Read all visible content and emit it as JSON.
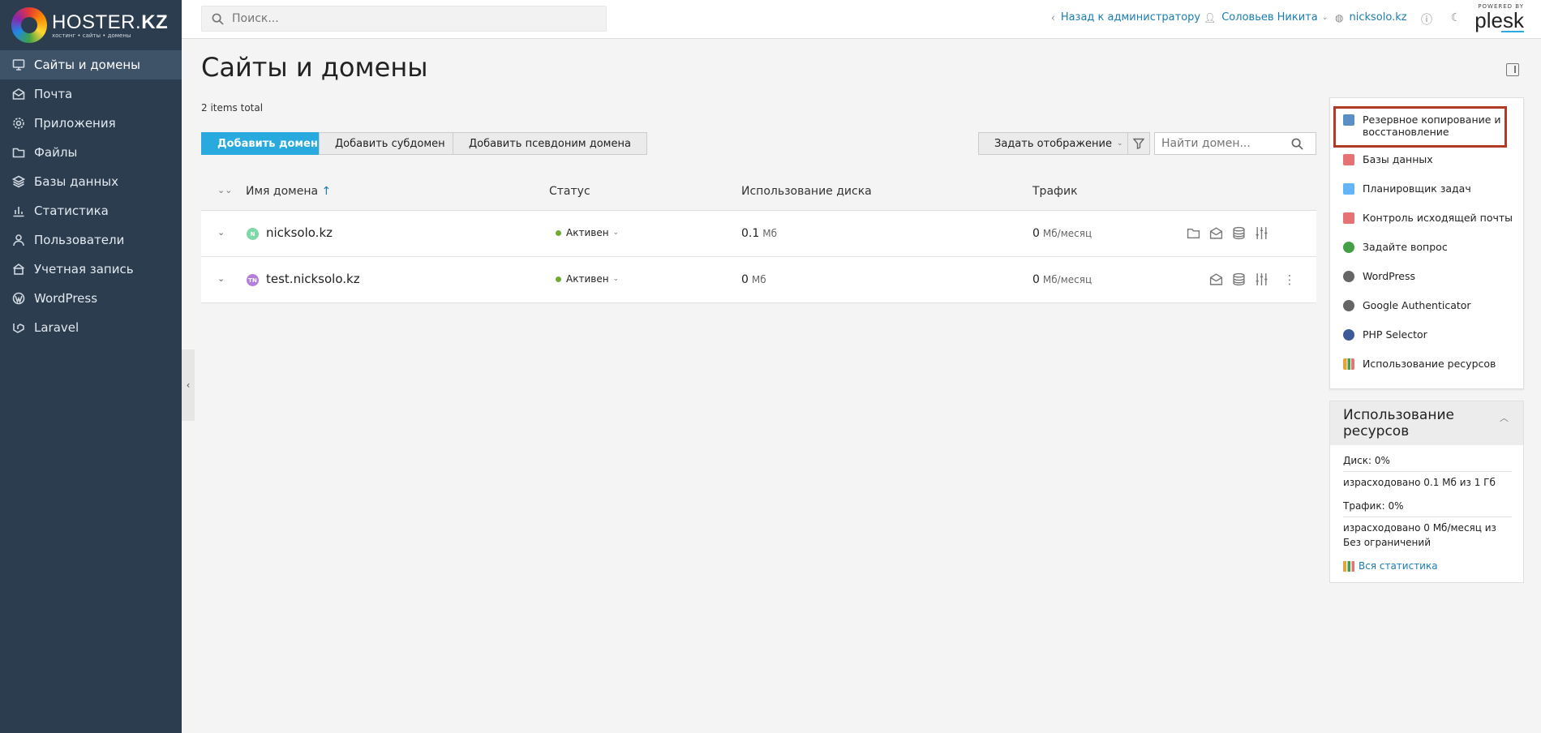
{
  "brand": {
    "logo_main": "HOSTER.",
    "logo_bold": "KZ",
    "logo_sub": "хостинг • сайты • домены"
  },
  "sidebar": {
    "items": [
      {
        "label": "Сайты и домены",
        "icon": "monitor-icon",
        "active": true
      },
      {
        "label": "Почта",
        "icon": "mail-icon"
      },
      {
        "label": "Приложения",
        "icon": "gear-icon"
      },
      {
        "label": "Файлы",
        "icon": "folder-icon"
      },
      {
        "label": "Базы данных",
        "icon": "layers-icon"
      },
      {
        "label": "Статистика",
        "icon": "chart-icon"
      },
      {
        "label": "Пользователи",
        "icon": "user-icon"
      },
      {
        "label": "Учетная запись",
        "icon": "account-icon"
      },
      {
        "label": "WordPress",
        "icon": "wordpress-icon"
      },
      {
        "label": "Laravel",
        "icon": "laravel-icon"
      }
    ]
  },
  "header": {
    "search_placeholder": "Поиск...",
    "back_label": "Назад к администратору",
    "user_label": "Соловьев Никита",
    "domain_label": "nicksolo.kz",
    "powered_by": "POWERED BY",
    "plesk": "plesk"
  },
  "main": {
    "title": "Сайты и домены",
    "items_total": "2 items total",
    "buttons": {
      "add_domain": "Добавить домен",
      "add_subdomain": "Добавить субдомен",
      "add_alias": "Добавить псевдоним домена",
      "set_view": "Задать отображение"
    },
    "domain_search_placeholder": "Найти домен...",
    "columns": {
      "name": "Имя домена",
      "status": "Статус",
      "disk": "Использование диска",
      "traffic": "Трафик"
    },
    "rows": [
      {
        "name": "nicksolo.kz",
        "favicon": "N",
        "favicon_color": "#7ed8a8",
        "status": "Активен",
        "disk": "0.1",
        "disk_unit": "Мб",
        "traffic": "0",
        "traffic_unit": "Мб/месяц"
      },
      {
        "name": "test.nicksolo.kz",
        "favicon": "TN",
        "favicon_color": "#b57edc",
        "status": "Активен",
        "disk": "0",
        "disk_unit": "Мб",
        "traffic": "0",
        "traffic_unit": "Мб/месяц"
      }
    ]
  },
  "quick_links": [
    {
      "label": "Резервное копирование и восстановление",
      "icon": "backup-icon",
      "color": "#5b8fc4"
    },
    {
      "label": "Базы данных",
      "icon": "database-icon",
      "color": "#e57373"
    },
    {
      "label": "Планировщик задач",
      "icon": "calendar-icon",
      "color": "#64b5f6"
    },
    {
      "label": "Контроль исходящей почты",
      "icon": "mail-control-icon",
      "color": "#e57373"
    },
    {
      "label": "Задайте вопрос",
      "icon": "whatsapp-icon",
      "color": "#43a047"
    },
    {
      "label": "WordPress",
      "icon": "wordpress-icon",
      "color": "#666666"
    },
    {
      "label": "Google Authenticator",
      "icon": "authenticator-icon",
      "color": "#666666"
    },
    {
      "label": "PHP Selector",
      "icon": "php-icon",
      "color": "#3d5a98"
    },
    {
      "label": "Использование ресурсов",
      "icon": "stats-icon",
      "color": "#e6a23c"
    }
  ],
  "resources": {
    "title": "Использование ресурсов",
    "disk_label": "Диск: 0%",
    "disk_detail": "израсходовано 0.1 Мб из 1 Гб",
    "traffic_label": "Трафик: 0%",
    "traffic_detail": "израсходовано 0 Мб/месяц из Без ограничений",
    "all_stats": "Вся статистика"
  }
}
